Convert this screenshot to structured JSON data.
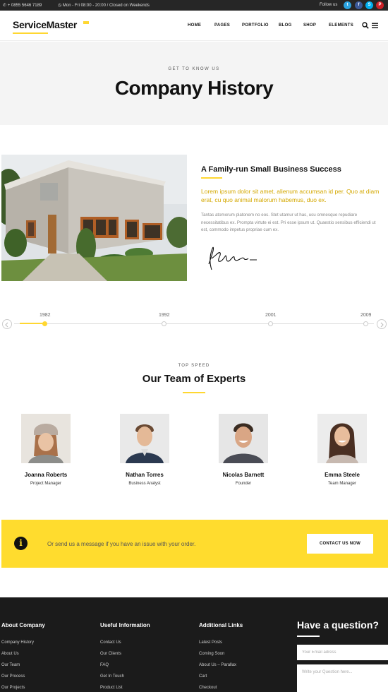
{
  "topbar": {
    "phone": "+ 0855 5646 7189",
    "hours": "Mon - Fri 08:00 - 20:00 / Closed on Weekends",
    "follow_label": "Follow us",
    "social": {
      "twitter": "t",
      "facebook": "f",
      "skype": "S",
      "pinterest": "P"
    }
  },
  "header": {
    "logo": "ServiceMaster",
    "nav": [
      "HOME",
      "PAGES",
      "PORTFOLIO",
      "BLOG",
      "SHOP",
      "ELEMENTS"
    ]
  },
  "hero": {
    "kicker": "GET TO KNOW US",
    "title": "Company History"
  },
  "about": {
    "title": "A Family-run Small Business Success",
    "lead": "Lorem ipsum dolor sit amet, alienum accumsan id per. Quo at diam erat, cu quo animal malorum habemus, duo ex.",
    "body": "Tantas atomorum platonem no eos. Stet utamur ut has, usu omnesque repudiare necessitatibus ex. Prompta virtute ei est. Pri esse ipsum ut. Quaestio sensibus efficiendi ut est, commodo impetus propriae cum ex."
  },
  "timeline": {
    "years": [
      "1982",
      "1992",
      "2001",
      "2009"
    ],
    "active_index": 0
  },
  "team": {
    "kicker": "TOP SPEED",
    "title": "Our Team of Experts",
    "members": [
      {
        "name": "Joanna Roberts",
        "role": "Project Manager"
      },
      {
        "name": "Nathan Torres",
        "role": "Business Analyst"
      },
      {
        "name": "Nicolas Barnett",
        "role": "Founder"
      },
      {
        "name": "Emma Steele",
        "role": "Team Manager"
      }
    ]
  },
  "cta": {
    "icon": "i",
    "text": "Or send us a message if you have an issue with your order.",
    "button": "CONTACT US NOW"
  },
  "footer": {
    "col1": {
      "title": "About Company",
      "links": [
        "Company History",
        "About Us",
        "Our Team",
        "Our Process",
        "Our Projects"
      ]
    },
    "col2": {
      "title": "Useful Information",
      "links": [
        "Contact Us",
        "Our Clients",
        "FAQ",
        "Get In Touch",
        "Product List"
      ]
    },
    "col3": {
      "title": "Additional Links",
      "links": [
        "Latest Posts",
        "Coming Soon",
        "About Us – Parallax",
        "Cart",
        "Checkout"
      ]
    },
    "question": {
      "title": "Have a question?",
      "email_placeholder": "Your Email adress",
      "message_placeholder": "Write your Question here..."
    }
  },
  "colors": {
    "accent": "#ffd731",
    "dark": "#1b1b1b",
    "topbar": "#262626"
  }
}
